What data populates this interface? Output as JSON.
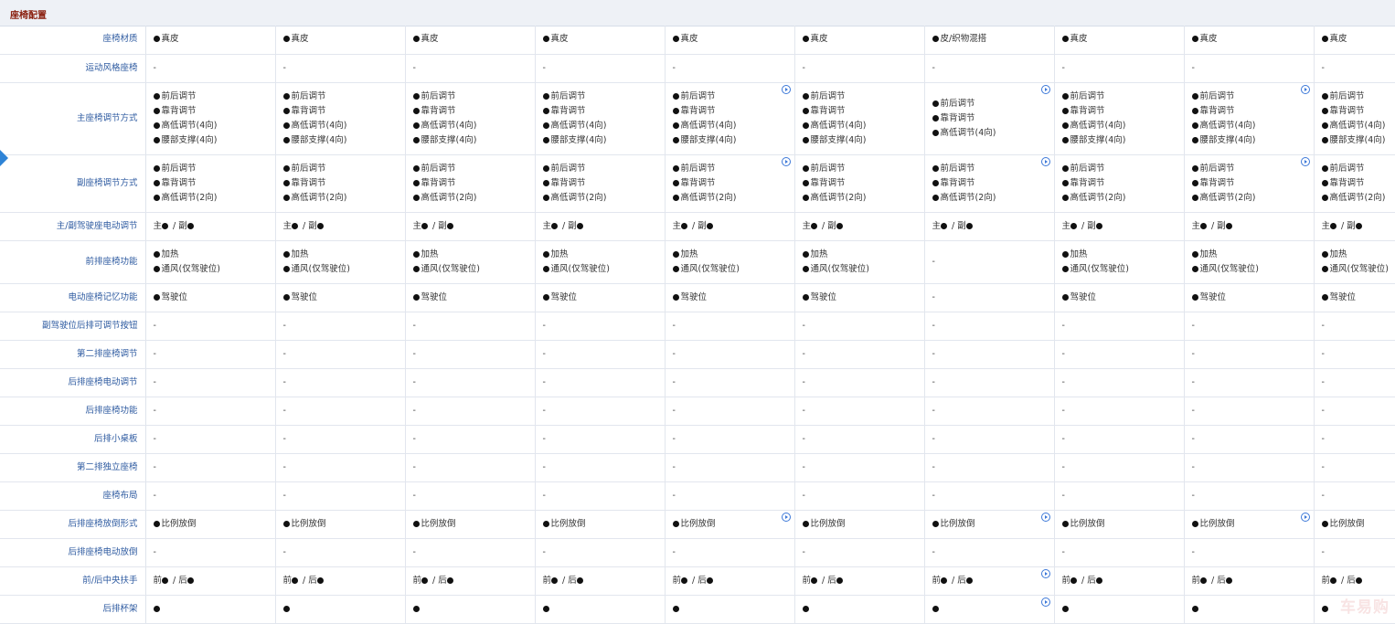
{
  "section": {
    "title": "座椅配置"
  },
  "watermark": "车易购",
  "rows": [
    {
      "label": "座椅材质",
      "cells": [
        {
          "items": [
            "●真皮"
          ]
        },
        {
          "items": [
            "●真皮"
          ]
        },
        {
          "items": [
            "●真皮"
          ]
        },
        {
          "items": [
            "●真皮"
          ]
        },
        {
          "items": [
            "●真皮"
          ]
        },
        {
          "items": [
            "●真皮"
          ]
        },
        {
          "items": [
            "●皮/织物混搭"
          ]
        },
        {
          "items": [
            "●真皮"
          ]
        },
        {
          "items": [
            "●真皮"
          ]
        },
        {
          "items": [
            "●真皮"
          ]
        }
      ]
    },
    {
      "label": "运动风格座椅",
      "cells": [
        {
          "items": [
            "-"
          ]
        },
        {
          "items": [
            "-"
          ]
        },
        {
          "items": [
            "-"
          ]
        },
        {
          "items": [
            "-"
          ]
        },
        {
          "items": [
            "-"
          ]
        },
        {
          "items": [
            "-"
          ]
        },
        {
          "items": [
            "-"
          ]
        },
        {
          "items": [
            "-"
          ]
        },
        {
          "items": [
            "-"
          ]
        },
        {
          "items": [
            "-"
          ]
        }
      ]
    },
    {
      "label": "主座椅调节方式",
      "cells": [
        {
          "items": [
            "●前后调节",
            "●靠背调节",
            "●高低调节(4向)",
            "●腰部支撑(4向)"
          ]
        },
        {
          "items": [
            "●前后调节",
            "●靠背调节",
            "●高低调节(4向)",
            "●腰部支撑(4向)"
          ]
        },
        {
          "items": [
            "●前后调节",
            "●靠背调节",
            "●高低调节(4向)",
            "●腰部支撑(4向)"
          ]
        },
        {
          "items": [
            "●前后调节",
            "●靠背调节",
            "●高低调节(4向)",
            "●腰部支撑(4向)"
          ]
        },
        {
          "items": [
            "●前后调节",
            "●靠背调节",
            "●高低调节(4向)",
            "●腰部支撑(4向)"
          ],
          "icon": true
        },
        {
          "items": [
            "●前后调节",
            "●靠背调节",
            "●高低调节(4向)",
            "●腰部支撑(4向)"
          ]
        },
        {
          "items": [
            "●前后调节",
            "●靠背调节",
            "●高低调节(4向)"
          ],
          "icon": true
        },
        {
          "items": [
            "●前后调节",
            "●靠背调节",
            "●高低调节(4向)",
            "●腰部支撑(4向)"
          ]
        },
        {
          "items": [
            "●前后调节",
            "●靠背调节",
            "●高低调节(4向)",
            "●腰部支撑(4向)"
          ],
          "icon": true
        },
        {
          "items": [
            "●前后调节",
            "●靠背调节",
            "●高低调节(4向)",
            "●腰部支撑(4向)"
          ]
        }
      ]
    },
    {
      "label": "副座椅调节方式",
      "cells": [
        {
          "items": [
            "●前后调节",
            "●靠背调节",
            "●高低调节(2向)"
          ]
        },
        {
          "items": [
            "●前后调节",
            "●靠背调节",
            "●高低调节(2向)"
          ]
        },
        {
          "items": [
            "●前后调节",
            "●靠背调节",
            "●高低调节(2向)"
          ]
        },
        {
          "items": [
            "●前后调节",
            "●靠背调节",
            "●高低调节(2向)"
          ]
        },
        {
          "items": [
            "●前后调节",
            "●靠背调节",
            "●高低调节(2向)"
          ],
          "icon": true
        },
        {
          "items": [
            "●前后调节",
            "●靠背调节",
            "●高低调节(2向)"
          ]
        },
        {
          "items": [
            "●前后调节",
            "●靠背调节",
            "●高低调节(2向)"
          ],
          "icon": true
        },
        {
          "items": [
            "●前后调节",
            "●靠背调节",
            "●高低调节(2向)"
          ]
        },
        {
          "items": [
            "●前后调节",
            "●靠背调节",
            "●高低调节(2向)"
          ],
          "icon": true
        },
        {
          "items": [
            "●前后调节",
            "●靠背调节",
            "●高低调节(2向)"
          ]
        }
      ]
    },
    {
      "label": "主/副驾驶座电动调节",
      "cells": [
        {
          "items": [
            "主● / 副●"
          ]
        },
        {
          "items": [
            "主● / 副●"
          ]
        },
        {
          "items": [
            "主● / 副●"
          ]
        },
        {
          "items": [
            "主● / 副●"
          ]
        },
        {
          "items": [
            "主● / 副●"
          ]
        },
        {
          "items": [
            "主● / 副●"
          ]
        },
        {
          "items": [
            "主● / 副●"
          ]
        },
        {
          "items": [
            "主● / 副●"
          ]
        },
        {
          "items": [
            "主● / 副●"
          ]
        },
        {
          "items": [
            "主● / 副●"
          ]
        }
      ]
    },
    {
      "label": "前排座椅功能",
      "cells": [
        {
          "items": [
            "●加热",
            "●通风(仅驾驶位)"
          ]
        },
        {
          "items": [
            "●加热",
            "●通风(仅驾驶位)"
          ]
        },
        {
          "items": [
            "●加热",
            "●通风(仅驾驶位)"
          ]
        },
        {
          "items": [
            "●加热",
            "●通风(仅驾驶位)"
          ]
        },
        {
          "items": [
            "●加热",
            "●通风(仅驾驶位)"
          ]
        },
        {
          "items": [
            "●加热",
            "●通风(仅驾驶位)"
          ]
        },
        {
          "items": [
            "-"
          ]
        },
        {
          "items": [
            "●加热",
            "●通风(仅驾驶位)"
          ]
        },
        {
          "items": [
            "●加热",
            "●通风(仅驾驶位)"
          ]
        },
        {
          "items": [
            "●加热",
            "●通风(仅驾驶位)"
          ]
        }
      ]
    },
    {
      "label": "电动座椅记忆功能",
      "cells": [
        {
          "items": [
            "●驾驶位"
          ]
        },
        {
          "items": [
            "●驾驶位"
          ]
        },
        {
          "items": [
            "●驾驶位"
          ]
        },
        {
          "items": [
            "●驾驶位"
          ]
        },
        {
          "items": [
            "●驾驶位"
          ]
        },
        {
          "items": [
            "●驾驶位"
          ]
        },
        {
          "items": [
            "-"
          ]
        },
        {
          "items": [
            "●驾驶位"
          ]
        },
        {
          "items": [
            "●驾驶位"
          ]
        },
        {
          "items": [
            "●驾驶位"
          ]
        }
      ]
    },
    {
      "label": "副驾驶位后排可调节按钮",
      "cells": [
        {
          "items": [
            "-"
          ]
        },
        {
          "items": [
            "-"
          ]
        },
        {
          "items": [
            "-"
          ]
        },
        {
          "items": [
            "-"
          ]
        },
        {
          "items": [
            "-"
          ]
        },
        {
          "items": [
            "-"
          ]
        },
        {
          "items": [
            "-"
          ]
        },
        {
          "items": [
            "-"
          ]
        },
        {
          "items": [
            "-"
          ]
        },
        {
          "items": [
            "-"
          ]
        }
      ]
    },
    {
      "label": "第二排座椅调节",
      "cells": [
        {
          "items": [
            "-"
          ]
        },
        {
          "items": [
            "-"
          ]
        },
        {
          "items": [
            "-"
          ]
        },
        {
          "items": [
            "-"
          ]
        },
        {
          "items": [
            "-"
          ]
        },
        {
          "items": [
            "-"
          ]
        },
        {
          "items": [
            "-"
          ]
        },
        {
          "items": [
            "-"
          ]
        },
        {
          "items": [
            "-"
          ]
        },
        {
          "items": [
            "-"
          ]
        }
      ]
    },
    {
      "label": "后排座椅电动调节",
      "cells": [
        {
          "items": [
            "-"
          ]
        },
        {
          "items": [
            "-"
          ]
        },
        {
          "items": [
            "-"
          ]
        },
        {
          "items": [
            "-"
          ]
        },
        {
          "items": [
            "-"
          ]
        },
        {
          "items": [
            "-"
          ]
        },
        {
          "items": [
            "-"
          ]
        },
        {
          "items": [
            "-"
          ]
        },
        {
          "items": [
            "-"
          ]
        },
        {
          "items": [
            "-"
          ]
        }
      ]
    },
    {
      "label": "后排座椅功能",
      "cells": [
        {
          "items": [
            "-"
          ]
        },
        {
          "items": [
            "-"
          ]
        },
        {
          "items": [
            "-"
          ]
        },
        {
          "items": [
            "-"
          ]
        },
        {
          "items": [
            "-"
          ]
        },
        {
          "items": [
            "-"
          ]
        },
        {
          "items": [
            "-"
          ]
        },
        {
          "items": [
            "-"
          ]
        },
        {
          "items": [
            "-"
          ]
        },
        {
          "items": [
            "-"
          ]
        }
      ]
    },
    {
      "label": "后排小桌板",
      "cells": [
        {
          "items": [
            "-"
          ]
        },
        {
          "items": [
            "-"
          ]
        },
        {
          "items": [
            "-"
          ]
        },
        {
          "items": [
            "-"
          ]
        },
        {
          "items": [
            "-"
          ]
        },
        {
          "items": [
            "-"
          ]
        },
        {
          "items": [
            "-"
          ]
        },
        {
          "items": [
            "-"
          ]
        },
        {
          "items": [
            "-"
          ]
        },
        {
          "items": [
            "-"
          ]
        }
      ]
    },
    {
      "label": "第二排独立座椅",
      "cells": [
        {
          "items": [
            "-"
          ]
        },
        {
          "items": [
            "-"
          ]
        },
        {
          "items": [
            "-"
          ]
        },
        {
          "items": [
            "-"
          ]
        },
        {
          "items": [
            "-"
          ]
        },
        {
          "items": [
            "-"
          ]
        },
        {
          "items": [
            "-"
          ]
        },
        {
          "items": [
            "-"
          ]
        },
        {
          "items": [
            "-"
          ]
        },
        {
          "items": [
            "-"
          ]
        }
      ]
    },
    {
      "label": "座椅布局",
      "cells": [
        {
          "items": [
            "-"
          ]
        },
        {
          "items": [
            "-"
          ]
        },
        {
          "items": [
            "-"
          ]
        },
        {
          "items": [
            "-"
          ]
        },
        {
          "items": [
            "-"
          ]
        },
        {
          "items": [
            "-"
          ]
        },
        {
          "items": [
            "-"
          ]
        },
        {
          "items": [
            "-"
          ]
        },
        {
          "items": [
            "-"
          ]
        },
        {
          "items": [
            "-"
          ]
        }
      ]
    },
    {
      "label": "后排座椅放倒形式",
      "cells": [
        {
          "items": [
            "●比例放倒"
          ]
        },
        {
          "items": [
            "●比例放倒"
          ]
        },
        {
          "items": [
            "●比例放倒"
          ]
        },
        {
          "items": [
            "●比例放倒"
          ]
        },
        {
          "items": [
            "●比例放倒"
          ],
          "icon": true
        },
        {
          "items": [
            "●比例放倒"
          ]
        },
        {
          "items": [
            "●比例放倒"
          ],
          "icon": true
        },
        {
          "items": [
            "●比例放倒"
          ]
        },
        {
          "items": [
            "●比例放倒"
          ],
          "icon": true
        },
        {
          "items": [
            "●比例放倒"
          ]
        }
      ]
    },
    {
      "label": "后排座椅电动放倒",
      "cells": [
        {
          "items": [
            "-"
          ]
        },
        {
          "items": [
            "-"
          ]
        },
        {
          "items": [
            "-"
          ]
        },
        {
          "items": [
            "-"
          ]
        },
        {
          "items": [
            "-"
          ]
        },
        {
          "items": [
            "-"
          ]
        },
        {
          "items": [
            "-"
          ]
        },
        {
          "items": [
            "-"
          ]
        },
        {
          "items": [
            "-"
          ]
        },
        {
          "items": [
            "-"
          ]
        }
      ]
    },
    {
      "label": "前/后中央扶手",
      "cells": [
        {
          "items": [
            "前● / 后●"
          ]
        },
        {
          "items": [
            "前● / 后●"
          ]
        },
        {
          "items": [
            "前● / 后●"
          ]
        },
        {
          "items": [
            "前● / 后●"
          ]
        },
        {
          "items": [
            "前● / 后●"
          ]
        },
        {
          "items": [
            "前● / 后●"
          ]
        },
        {
          "items": [
            "前● / 后●"
          ],
          "icon": true
        },
        {
          "items": [
            "前● / 后●"
          ]
        },
        {
          "items": [
            "前● / 后●"
          ]
        },
        {
          "items": [
            "前● / 后●"
          ]
        }
      ]
    },
    {
      "label": "后排杯架",
      "cells": [
        {
          "items": [
            "●"
          ]
        },
        {
          "items": [
            "●"
          ]
        },
        {
          "items": [
            "●"
          ]
        },
        {
          "items": [
            "●"
          ]
        },
        {
          "items": [
            "●"
          ]
        },
        {
          "items": [
            "●"
          ]
        },
        {
          "items": [
            "●"
          ],
          "icon": true
        },
        {
          "items": [
            "●"
          ]
        },
        {
          "items": [
            "●"
          ]
        },
        {
          "items": [
            "●"
          ]
        }
      ]
    }
  ]
}
